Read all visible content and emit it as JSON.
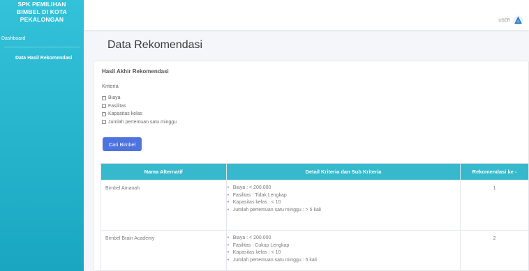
{
  "brand": {
    "line1": "SPK PEMILIHAN",
    "line2": "BIMBEL DI KOTA",
    "line3": "PEKALONGAN"
  },
  "sidebar": {
    "items": [
      {
        "label": "Dashboard"
      },
      {
        "label": "Data Hasil Rekomendasi"
      }
    ]
  },
  "topbar": {
    "user_label": "USER"
  },
  "page": {
    "title": "Data Rekomendasi"
  },
  "card": {
    "title": "Hasil Akhir Rekomendasi",
    "kriteria_label": "Kriteria",
    "checks": [
      {
        "label": "Biaya"
      },
      {
        "label": "Fasilitas"
      },
      {
        "label": "Kapasitas kelas"
      },
      {
        "label": "Jumlah pertemuan satu minggu"
      }
    ],
    "button_label": "Cari Bimbel"
  },
  "table": {
    "headers": [
      "Nama Alternatif",
      "Detail Kriteria dan Sub Kriteria",
      "Rekomendasi ke -"
    ],
    "rows": [
      {
        "name": "Bimbel Amanah",
        "details": [
          "Biaya : < 200.000",
          "Fasilitas : Tidak Lengkap",
          "Kapasitas kelas : < 10",
          "Jumlah pertemuan satu minggu : > 5 kali"
        ],
        "rank": "1"
      },
      {
        "name": "Bimbel Brain Academy",
        "details": [
          "Biaya : < 200.000",
          "Fasilitas : Cukup Lengkap",
          "Kapasitas kelas : < 10",
          "Jumlah pertemuan satu minggu : 5 kali"
        ],
        "rank": "2"
      }
    ]
  },
  "colors": {
    "sidebar": "#1fb2c9",
    "table_header": "#36b9cc",
    "button": "#4e73df"
  }
}
